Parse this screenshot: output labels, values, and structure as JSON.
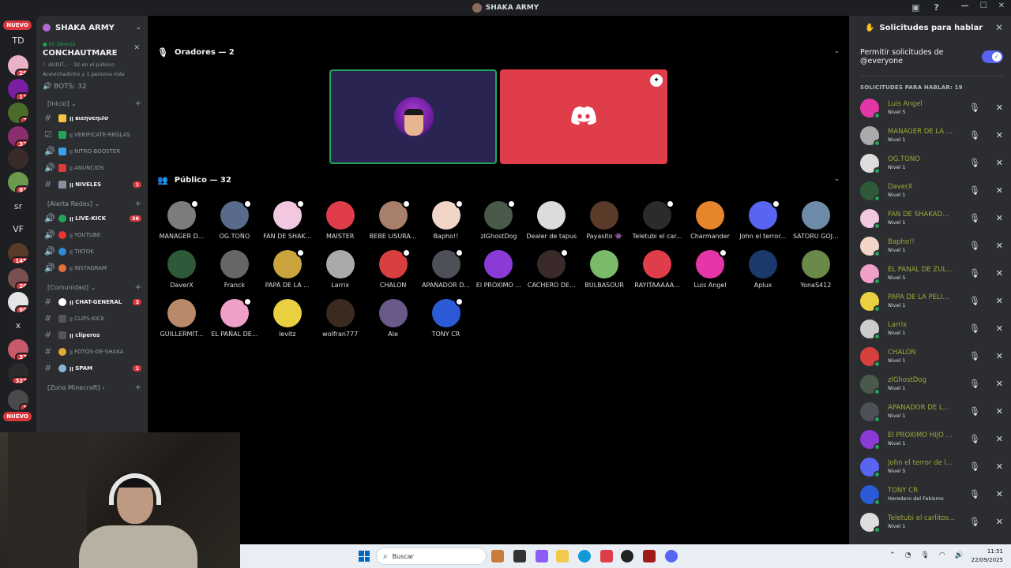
{
  "window": {
    "title": "SHAKA ARMY"
  },
  "rail": {
    "nuevo_top": "NUEVO",
    "nuevo_bottom": "NUEVO",
    "folders": [
      "TD",
      "sr",
      "VF",
      "x"
    ],
    "badges": [
      "29",
      "11",
      "7",
      "32",
      "81",
      "145",
      "20",
      "60",
      "37",
      "327",
      "3"
    ]
  },
  "sidebar": {
    "server_name": "SHAKA ARMY",
    "live": {
      "tag": "En Directo",
      "name": "CONCHAUTMARE",
      "meta1": "꒰ AUDIT...  · 32 en el público",
      "meta2": "Acevichadinho y 1 persona más",
      "bots": "BOTS: 32"
    },
    "categories": {
      "inicio": "[Inicio]",
      "alerta": "[Alerta Redes]",
      "comunidad": "[Comunidad]",
      "minecraft": "[Zona Minecraft]"
    },
    "channels": [
      {
        "label": "ꞁꞁ вιєηνєηι∂σ",
        "badge": ""
      },
      {
        "label": "ꞁꞁ VERIFICATE-REGLAS",
        "badge": ""
      },
      {
        "label": "ꞁꞁ NITRO-BOOSTER",
        "badge": ""
      },
      {
        "label": "ꞁꞁ ANUNCIOS",
        "badge": ""
      },
      {
        "label": "ꞁꞁ NIVELES",
        "badge": "1"
      },
      {
        "label": "ꞁꞁ LIVE-KICK",
        "badge": "36"
      },
      {
        "label": "ꞁꞁ YOUTUBE",
        "badge": ""
      },
      {
        "label": "ꞁꞁ TIKTOK",
        "badge": ""
      },
      {
        "label": "ꞁꞁ INSTAGRAM",
        "badge": ""
      },
      {
        "label": "ꞁꞁ CHAT-GENERAL",
        "badge": "3"
      },
      {
        "label": "ꞁꞁ CLIPS-KICK",
        "badge": ""
      },
      {
        "label": "ꞁꞁ cliperos",
        "badge": ""
      },
      {
        "label": "ꞁꞁ FOTOS-DE-SHAKA",
        "badge": ""
      },
      {
        "label": "ꞁꞁ SPAM",
        "badge": "1"
      }
    ]
  },
  "stage": {
    "speakers_header": "Oradores — 2",
    "audience_header": "Público — 32",
    "audience": [
      "MANAGER D...",
      "OG.TOÑO",
      "FAN DE SHAK...",
      "MAISTER",
      "BEBE LISURA...",
      "Bapho!!",
      "zlGhostDog",
      "Dealer de tapus",
      "Payasito 👾",
      "Teletubi el car...",
      "Charmander",
      "John el terror...",
      "SATORU GOJ...",
      "DaverX",
      "Franck",
      "PAPÁ DE LA ...",
      "Larrix",
      "CHALON",
      "APAÑADOR D...",
      "El PRÓXIMO ...",
      "CACHERO DE...",
      "BULBASOUR",
      "RAYITAAAAA...",
      "Luis Angel",
      "Aplux",
      "YonaS412",
      "GUILLERMIT...",
      "EL PAÑAL DE...",
      "levitz",
      "wolfran777",
      "Ale",
      "TONY CR"
    ]
  },
  "requests_panel": {
    "title": "Solicitudes para hablar",
    "permit_label": "Permitir solicitudes de @everyone",
    "list_label": "SOLICITUDES PARA HABLAR: 19",
    "items": [
      {
        "name": "Luis Angel",
        "level": "Nivel 5"
      },
      {
        "name": "MANAGER DE LA ...",
        "level": "Nivel 1"
      },
      {
        "name": "OG.TONO",
        "level": "Nivel 1"
      },
      {
        "name": "DaverX",
        "level": "Nivel 1"
      },
      {
        "name": "FAN DE SHAKAD...",
        "level": "Nivel 1"
      },
      {
        "name": "Bapho!!",
        "level": "Nivel 1"
      },
      {
        "name": "EL PAÑAL DE ZUL...",
        "level": "Nivel 5"
      },
      {
        "name": "PAPÁ DE LA PELI...",
        "level": "Nivel 1"
      },
      {
        "name": "Larrix",
        "level": "Nivel 1"
      },
      {
        "name": "CHALON",
        "level": "Nivel 1"
      },
      {
        "name": "zlGhostDog",
        "level": "Nivel 1"
      },
      {
        "name": "APANADOR DE L...",
        "level": "Nivel 1"
      },
      {
        "name": "El PRÓXIMO HIJO ...",
        "level": "Nivel 1"
      },
      {
        "name": "John el terror de l...",
        "level": "Nivel 5"
      },
      {
        "name": "TONY CR",
        "level": "Heredero del Fekismo"
      },
      {
        "name": "Teletubi el carlitos...",
        "level": "Nivel 1"
      }
    ]
  },
  "taskbar": {
    "search_placeholder": "Buscar",
    "time": "11:51",
    "date": "22/09/2025"
  },
  "colors": {
    "accent": "#5865f2",
    "online": "#23a559",
    "danger": "#da373c",
    "name_yellow": "#a3a837"
  }
}
